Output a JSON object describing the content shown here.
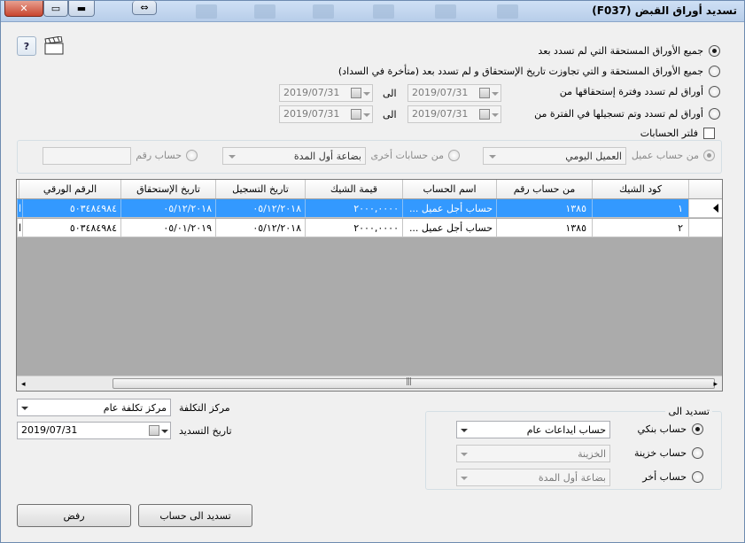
{
  "window": {
    "title": "تسديد أوراق القبض",
    "code": "(F037)"
  },
  "options": [
    {
      "label": "جميع الأوراق المستحقة التي لم تسدد بعد",
      "selected": true
    },
    {
      "label": "جميع الأوراق المستحقة و التي تجاوزت تاريخ الإستحقاق و لم تسدد بعد (متأخرة في السداد)",
      "selected": false
    },
    {
      "label": "أوراق لم تسدد وفترة إستحقاقها من",
      "selected": false,
      "from": "2019/07/31",
      "to_label": "الى",
      "to": "2019/07/31"
    },
    {
      "label": "أوراق لم تسدد وتم تسجيلها في الفترة من",
      "selected": false,
      "from": "2019/07/31",
      "to_label": "الى",
      "to": "2019/07/31"
    }
  ],
  "filter": {
    "label": "فلتر الحسابات",
    "customer_label": "من حساب عميل",
    "customer_value": "العميل اليومي",
    "other_label": "من حسابات أخرى",
    "other_value": "بضاعة أول المدة",
    "account_no_label": "حساب رقم",
    "account_no_value": ""
  },
  "grid": {
    "columns": [
      "كود الشيك",
      "من حساب رقم",
      "اسم الحساب",
      "قيمة الشيك",
      "تاريخ التسجيل",
      "تاريخ الإستحقاق",
      "الرقم الورقي"
    ],
    "rows": [
      {
        "code": "١",
        "from_account": "١٣٨٥",
        "account_name": "حساب أجل عميل ...",
        "amount": "٢٠٠٠,٠٠٠٠",
        "reg_date": "٠٥/١٢/٢٠١٨",
        "due_date": "٠٥/١٢/٢٠١٨",
        "paper_no": "٥٠٣٤٨٤٩٨٤",
        "extra": "ا"
      },
      {
        "code": "٢",
        "from_account": "١٣٨٥",
        "account_name": "حساب أجل عميل ...",
        "amount": "٢٠٠٠,٠٠٠٠",
        "reg_date": "٠٥/١٢/٢٠١٨",
        "due_date": "٠٥/٠١/٢٠١٩",
        "paper_no": "٥٠٣٤٨٤٩٨٤",
        "extra": "ا"
      }
    ]
  },
  "payment": {
    "cost_center_label": "مركز التكلفة",
    "cost_center_value": "مركز تكلفة عام",
    "date_label": "تاريخ التسديد",
    "date_value": "2019/07/31",
    "group_title": "تسديد الى",
    "bank_label": "حساب بنكي",
    "bank_value": "حساب ايداعات عام",
    "treasury_label": "حساب خزينة",
    "treasury_value": "الخزينة",
    "other_label": "حساب أخر",
    "other_value": "بضاعة أول المدة"
  },
  "buttons": {
    "pay": "تسديد الى حساب",
    "reject": "رفض",
    "help": "?"
  }
}
